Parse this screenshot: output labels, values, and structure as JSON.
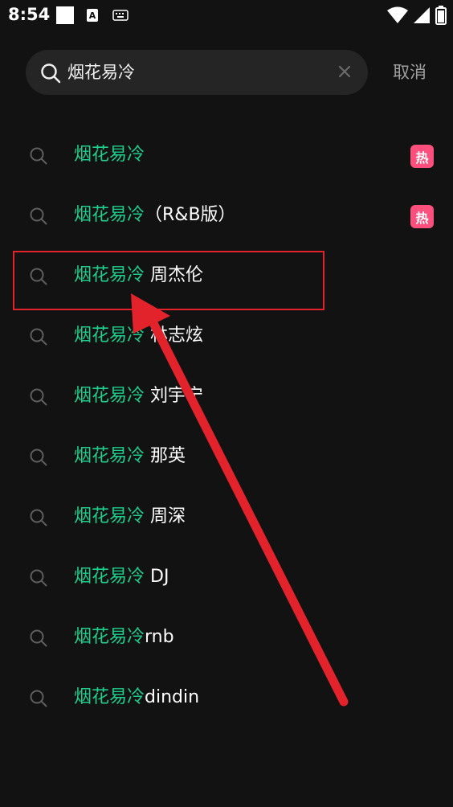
{
  "status_bar": {
    "time": "8:54",
    "notification_icons": [
      "blank-notification-icon",
      "a-notification-icon",
      "keyboard-icon"
    ],
    "system_icons": [
      "wifi-icon",
      "signal-icon",
      "battery-icon"
    ]
  },
  "search": {
    "query": "烟花易冷",
    "cancel_label": "取消"
  },
  "suggestions": [
    {
      "highlight": "烟花易冷",
      "rest": "",
      "badge": "热"
    },
    {
      "highlight": "烟花易冷",
      "rest": "（R&B版）",
      "badge": "热"
    },
    {
      "highlight": "烟花易冷",
      "rest": " 周杰伦",
      "badge": ""
    },
    {
      "highlight": "烟花易冷",
      "rest": " 林志炫",
      "badge": ""
    },
    {
      "highlight": "烟花易冷",
      "rest": " 刘宇宁",
      "badge": ""
    },
    {
      "highlight": "烟花易冷",
      "rest": " 那英",
      "badge": ""
    },
    {
      "highlight": "烟花易冷",
      "rest": " 周深",
      "badge": ""
    },
    {
      "highlight": "烟花易冷",
      "rest": " DJ",
      "badge": ""
    },
    {
      "highlight": "烟花易冷",
      "rest": "rnb",
      "badge": ""
    },
    {
      "highlight": "烟花易冷",
      "rest": "dindin",
      "badge": ""
    }
  ],
  "colors": {
    "background": "#121212",
    "highlight_text": "#1ecf8e",
    "hot_badge": "#ff4f7d",
    "annotation_red": "#e2232b"
  },
  "annotation": {
    "target_suggestion_index": 2
  }
}
